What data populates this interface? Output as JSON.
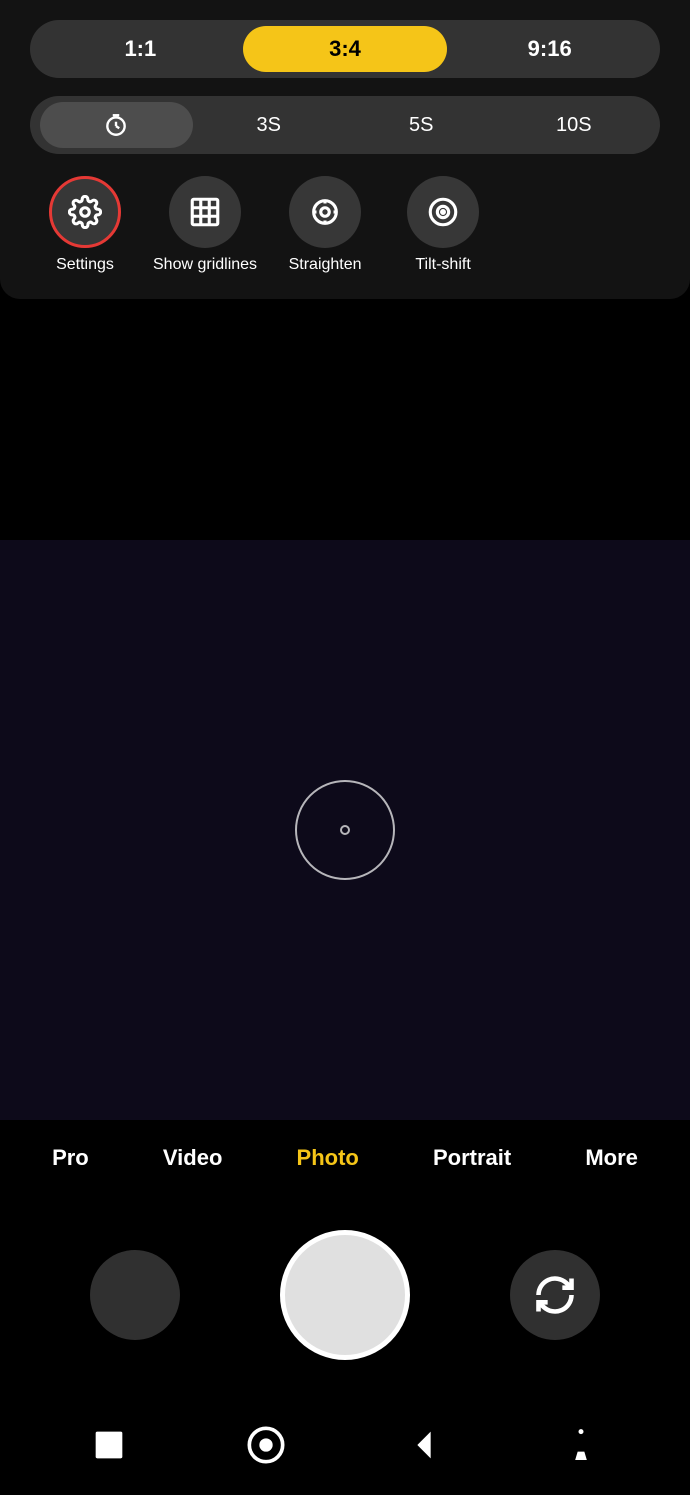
{
  "aspectRatio": {
    "options": [
      "1:1",
      "3:4",
      "9:16"
    ],
    "active": "3:4"
  },
  "timer": {
    "options": [
      "clock",
      "3S",
      "5S",
      "10S"
    ],
    "active": "clock"
  },
  "tools": [
    {
      "id": "settings",
      "label": "Settings",
      "active": true
    },
    {
      "id": "gridlines",
      "label": "Show gridlines",
      "active": false
    },
    {
      "id": "straighten",
      "label": "Straighten",
      "active": false
    },
    {
      "id": "tiltshift",
      "label": "Tilt-shift",
      "active": false
    }
  ],
  "modes": [
    {
      "id": "pro",
      "label": "Pro"
    },
    {
      "id": "video",
      "label": "Video"
    },
    {
      "id": "photo",
      "label": "Photo",
      "active": true
    },
    {
      "id": "portrait",
      "label": "Portrait"
    },
    {
      "id": "more",
      "label": "More"
    }
  ],
  "colors": {
    "accent": "#f5c518",
    "activeRed": "#e53935",
    "bg": "#000000",
    "panelBg": "rgba(20,20,20,0.97)"
  }
}
